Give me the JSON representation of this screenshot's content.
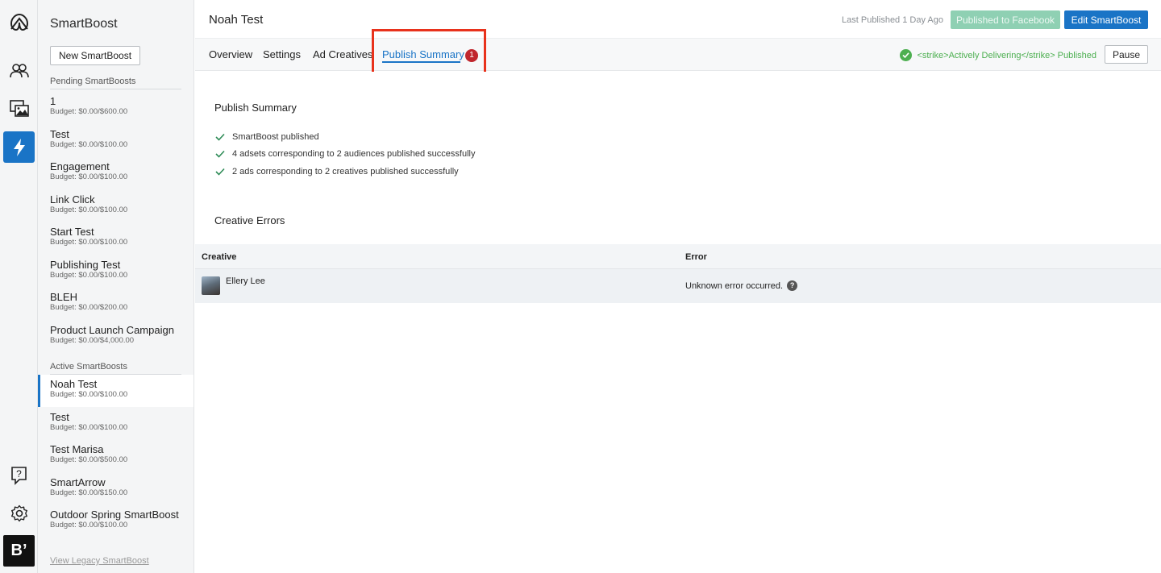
{
  "rail": {
    "icons": [
      "logo-icon",
      "audiences-icon",
      "creatives-icon",
      "smartboost-bolt-icon",
      "help-icon",
      "settings-icon",
      "brand-icon"
    ],
    "brand_label": "B’",
    "accent_color": "#1a74c6"
  },
  "sidebar": {
    "title": "SmartBoost",
    "new_button": "New SmartBoost",
    "pending_label": "Pending SmartBoosts",
    "pending": [
      {
        "name": "1",
        "budget": "Budget: $0.00/$600.00"
      },
      {
        "name": "Test",
        "budget": "Budget: $0.00/$100.00"
      },
      {
        "name": "Engagement",
        "budget": "Budget: $0.00/$100.00"
      },
      {
        "name": "Link Click",
        "budget": "Budget: $0.00/$100.00"
      },
      {
        "name": "Start Test",
        "budget": "Budget: $0.00/$100.00"
      },
      {
        "name": "Publishing Test",
        "budget": "Budget: $0.00/$100.00"
      },
      {
        "name": "BLEH",
        "budget": "Budget: $0.00/$200.00"
      },
      {
        "name": "Product Launch Campaign",
        "budget": "Budget: $0.00/$4,000.00"
      }
    ],
    "active_label": "Active SmartBoosts",
    "active": [
      {
        "name": "Noah Test",
        "budget": "Budget: $0.00/$100.00"
      },
      {
        "name": "Test",
        "budget": "Budget: $0.00/$100.00"
      },
      {
        "name": "Test Marisa",
        "budget": "Budget: $0.00/$500.00"
      },
      {
        "name": "SmartArrow",
        "budget": "Budget: $0.00/$150.00"
      },
      {
        "name": "Outdoor Spring SmartBoost",
        "budget": "Budget: $0.00/$100.00"
      }
    ],
    "legacy_link": "View Legacy SmartBoost"
  },
  "header": {
    "title": "Noah Test",
    "last_published": "Last Published 1 Day Ago",
    "published_button": "Published to Facebook",
    "edit_button": "Edit SmartBoost"
  },
  "tabs": {
    "items": [
      "Overview",
      "Settings",
      "Ad Creatives",
      "Publish Summary"
    ],
    "active": "Publish Summary",
    "badge": "1",
    "status_text": "<strike>Actively Delivering</strike> Published",
    "pause_button": "Pause"
  },
  "summary": {
    "title": "Publish Summary",
    "checks": [
      "SmartBoost published",
      "4 adsets corresponding to 2 audiences published successfully",
      "2 ads corresponding to 2 creatives published successfully"
    ]
  },
  "errors": {
    "title": "Creative Errors",
    "columns": [
      "Creative",
      "Error"
    ],
    "rows": [
      {
        "creative": "Ellery Lee",
        "error": "Unknown error occurred.",
        "help": "?"
      }
    ]
  }
}
